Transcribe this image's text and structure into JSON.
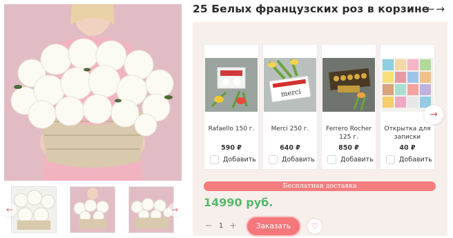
{
  "product": {
    "title": "25 Белых французских роз в корзине",
    "price": "14990 руб.",
    "free_delivery": "Бесплатная доставка",
    "order_label": "Заказать",
    "quantity": "1"
  },
  "nav": {
    "prev_icon": "arrow-left-icon",
    "next_icon": "arrow-right-icon",
    "prev_glyph": "←",
    "next_glyph": "→"
  },
  "addons": [
    {
      "name": "Rafaello 150 г.",
      "price": "590 ₽",
      "add_label": "Добавить"
    },
    {
      "name": "Merci 250 г.",
      "price": "640 ₽",
      "add_label": "Добавить"
    },
    {
      "name": "Ferrero Rocher 125 г.",
      "price": "850 ₽",
      "add_label": "Добавить"
    },
    {
      "name": "Открытка для записки",
      "price": "40 ₽",
      "add_label": "Добавить"
    }
  ],
  "qty_minus": "−",
  "qty_plus": "+",
  "fav_glyph": "♡",
  "cards_next_glyph": "→",
  "thumb_prev_glyph": "←",
  "thumb_next_glyph": "→",
  "colors": {
    "accent": "#f4777b",
    "price_green": "#55b86a",
    "panel_bg": "#f7efec"
  }
}
